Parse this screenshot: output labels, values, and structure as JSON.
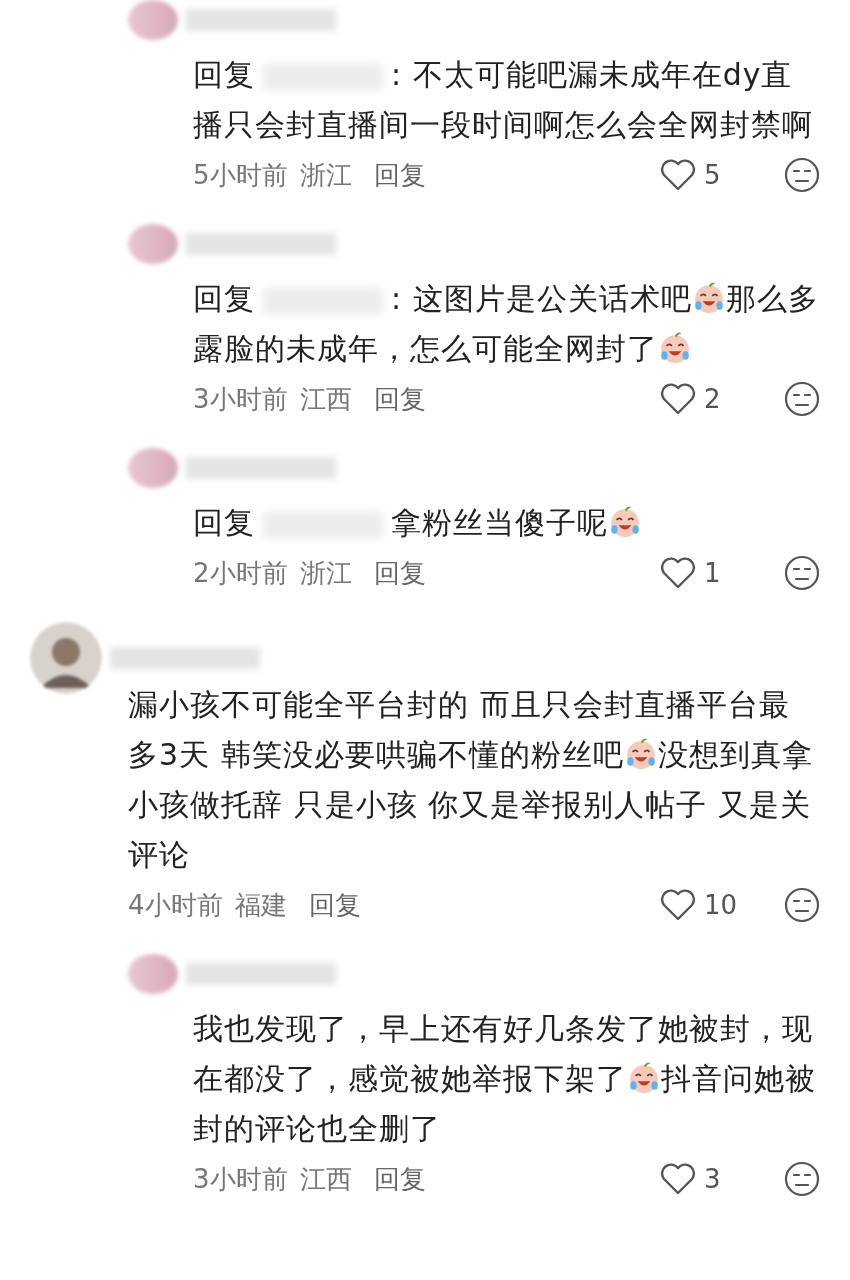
{
  "comments": [
    {
      "kind": "reply",
      "reply_prefix": "回复",
      "segments": [
        {
          "kind": "text",
          "text": ": 不太可能吧漏未成年在dy直播只会封直播间一段时间啊怎么会全网封禁啊"
        }
      ],
      "time": "5小时前",
      "region": "浙江",
      "reply_label": "回复",
      "likes": "5"
    },
    {
      "kind": "reply",
      "reply_prefix": "回复",
      "segments": [
        {
          "kind": "text",
          "text": ": 这图片是公关话术吧"
        },
        {
          "kind": "emoji"
        },
        {
          "kind": "text",
          "text": "那么多露脸的未成年，怎么可能全网封了"
        },
        {
          "kind": "emoji"
        }
      ],
      "time": "3小时前",
      "region": "江西",
      "reply_label": "回复",
      "likes": "2"
    },
    {
      "kind": "reply",
      "reply_prefix": "回复",
      "segments": [
        {
          "kind": "text",
          "text": "拿粉丝当傻子呢"
        },
        {
          "kind": "emoji"
        }
      ],
      "time": "2小时前",
      "region": "浙江",
      "reply_label": "回复",
      "likes": "1"
    },
    {
      "kind": "top",
      "segments": [
        {
          "kind": "text",
          "text": "漏小孩不可能全平台封的 而且只会封直播平台最多3天 韩笑没必要哄骗不懂的粉丝吧"
        },
        {
          "kind": "emoji"
        },
        {
          "kind": "text",
          "text": "没想到真拿小孩做托辞 只是小孩 你又是举报别人帖子 又是关评论"
        }
      ],
      "time": "4小时前",
      "region": "福建",
      "reply_label": "回复",
      "likes": "10"
    },
    {
      "kind": "reply",
      "segments": [
        {
          "kind": "text",
          "text": "我也发现了，早上还有好几条发了她被封，现在都没了，感觉被她举报下架了"
        },
        {
          "kind": "emoji"
        },
        {
          "kind": "text",
          "text": "抖音问她被封的评论也全删了"
        }
      ],
      "time": "3小时前",
      "region": "江西",
      "reply_label": "回复",
      "likes": "3"
    }
  ]
}
